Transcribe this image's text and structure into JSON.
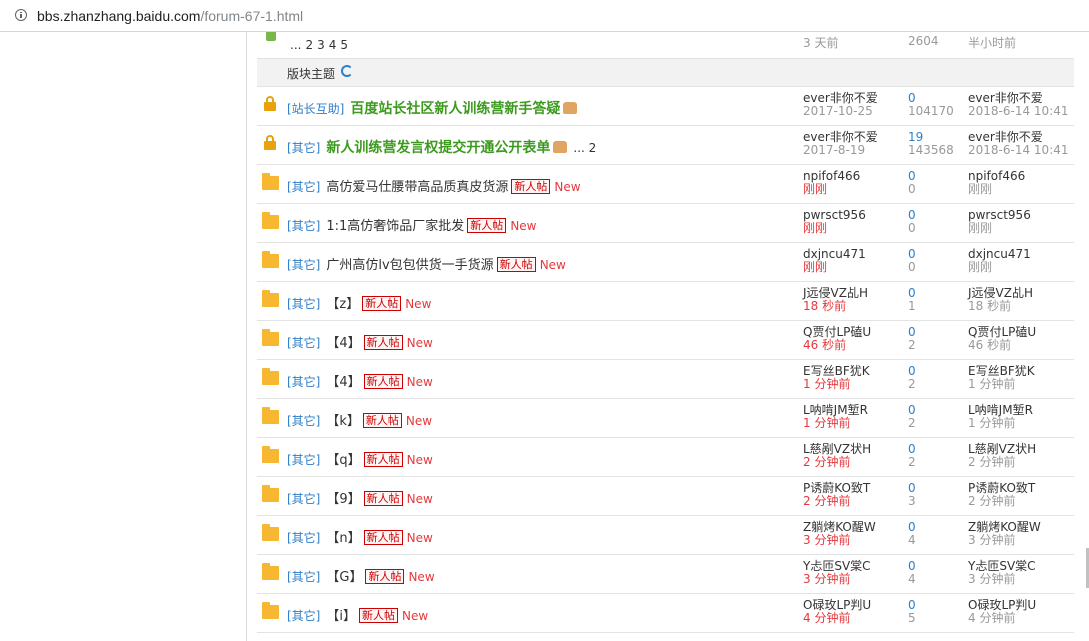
{
  "browser": {
    "url_host": "bbs.zhanzhang.baidu.com",
    "url_path": "/forum-67-1.html"
  },
  "prev_row": {
    "pages": [
      "...",
      "2",
      "3",
      "4",
      "5"
    ],
    "time": "3 天前",
    "count": "2604",
    "last": "半小时前"
  },
  "section": {
    "label": "版块主题"
  },
  "threads": [
    {
      "icon": "lock",
      "type": "[站长互助]",
      "subject": "百度站长社区新人训练营新手答疑",
      "highlight": true,
      "thumb": true,
      "pagelink": "",
      "newbie": "",
      "newtag": "",
      "author": "ever非你不爱",
      "date": "2017-10-25",
      "date_recent": false,
      "replies": "0",
      "views": "104170",
      "last_author": "ever非你不爱",
      "last_time": "2018-6-14 10:41"
    },
    {
      "icon": "lock",
      "type": "[其它]",
      "subject": "新人训练营发言权提交开通公开表单",
      "highlight": true,
      "thumb": true,
      "pagelink": "... 2",
      "newbie": "",
      "newtag": "",
      "author": "ever非你不爱",
      "date": "2017-8-19",
      "date_recent": false,
      "replies": "19",
      "views": "143568",
      "last_author": "ever非你不爱",
      "last_time": "2018-6-14 10:41"
    },
    {
      "icon": "folder",
      "type": "[其它]",
      "subject": "高仿爱马仕腰带高品质真皮货源",
      "highlight": false,
      "thumb": false,
      "pagelink": "",
      "newbie": "新人帖",
      "newtag": "New",
      "author": "npifof466",
      "date": "刚刚",
      "date_recent": true,
      "replies": "0",
      "views": "0",
      "last_author": "npifof466",
      "last_time": "刚刚"
    },
    {
      "icon": "folder",
      "type": "[其它]",
      "subject": "1:1高仿奢饰品厂家批发",
      "highlight": false,
      "thumb": false,
      "pagelink": "",
      "newbie": "新人帖",
      "newtag": "New",
      "author": "pwrsct956",
      "date": "刚刚",
      "date_recent": true,
      "replies": "0",
      "views": "0",
      "last_author": "pwrsct956",
      "last_time": "刚刚"
    },
    {
      "icon": "folder",
      "type": "[其它]",
      "subject": "广州高仿lv包包供货一手货源",
      "highlight": false,
      "thumb": false,
      "pagelink": "",
      "newbie": "新人帖",
      "newtag": "New",
      "author": "dxjncu471",
      "date": "刚刚",
      "date_recent": true,
      "replies": "0",
      "views": "0",
      "last_author": "dxjncu471",
      "last_time": "刚刚"
    },
    {
      "icon": "folder",
      "type": "[其它]",
      "subject": "【z】",
      "highlight": false,
      "thumb": false,
      "pagelink": "",
      "newbie": "新人帖",
      "newtag": "New",
      "author": "J远侵VZ乩H",
      "date": "18 秒前",
      "date_recent": true,
      "replies": "0",
      "views": "1",
      "last_author": "J远侵VZ乩H",
      "last_time": "18 秒前"
    },
    {
      "icon": "folder",
      "type": "[其它]",
      "subject": "【4】",
      "highlight": false,
      "thumb": false,
      "pagelink": "",
      "newbie": "新人帖",
      "newtag": "New",
      "author": "Q贾付LP磕U",
      "date": "46 秒前",
      "date_recent": true,
      "replies": "0",
      "views": "2",
      "last_author": "Q贾付LP磕U",
      "last_time": "46 秒前"
    },
    {
      "icon": "folder",
      "type": "[其它]",
      "subject": "【4】",
      "highlight": false,
      "thumb": false,
      "pagelink": "",
      "newbie": "新人帖",
      "newtag": "New",
      "author": "E写丝BF犹K",
      "date": "1 分钟前",
      "date_recent": true,
      "replies": "0",
      "views": "2",
      "last_author": "E写丝BF犹K",
      "last_time": "1 分钟前"
    },
    {
      "icon": "folder",
      "type": "[其它]",
      "subject": "【k】",
      "highlight": false,
      "thumb": false,
      "pagelink": "",
      "newbie": "新人帖",
      "newtag": "New",
      "author": "L呐啃JM堑R",
      "date": "1 分钟前",
      "date_recent": true,
      "replies": "0",
      "views": "2",
      "last_author": "L呐啃JM堑R",
      "last_time": "1 分钟前"
    },
    {
      "icon": "folder",
      "type": "[其它]",
      "subject": "【q】",
      "highlight": false,
      "thumb": false,
      "pagelink": "",
      "newbie": "新人帖",
      "newtag": "New",
      "author": "L慈剐VZ状H",
      "date": "2 分钟前",
      "date_recent": true,
      "replies": "0",
      "views": "2",
      "last_author": "L慈剐VZ状H",
      "last_time": "2 分钟前"
    },
    {
      "icon": "folder",
      "type": "[其它]",
      "subject": "【9】",
      "highlight": false,
      "thumb": false,
      "pagelink": "",
      "newbie": "新人帖",
      "newtag": "New",
      "author": "P诱蔚KO致T",
      "date": "2 分钟前",
      "date_recent": true,
      "replies": "0",
      "views": "3",
      "last_author": "P诱蔚KO致T",
      "last_time": "2 分钟前"
    },
    {
      "icon": "folder",
      "type": "[其它]",
      "subject": "【n】",
      "highlight": false,
      "thumb": false,
      "pagelink": "",
      "newbie": "新人帖",
      "newtag": "New",
      "author": "Z躺烤KO醒W",
      "date": "3 分钟前",
      "date_recent": true,
      "replies": "0",
      "views": "4",
      "last_author": "Z躺烤KO醒W",
      "last_time": "3 分钟前"
    },
    {
      "icon": "folder",
      "type": "[其它]",
      "subject": "【G】",
      "highlight": false,
      "thumb": false,
      "pagelink": "",
      "newbie": "新人帖",
      "newtag": "New",
      "author": "Y忐匝SV棠C",
      "date": "3 分钟前",
      "date_recent": true,
      "replies": "0",
      "views": "4",
      "last_author": "Y忐匝SV棠C",
      "last_time": "3 分钟前"
    },
    {
      "icon": "folder",
      "type": "[其它]",
      "subject": "【i】",
      "highlight": false,
      "thumb": false,
      "pagelink": "",
      "newbie": "新人帖",
      "newtag": "New",
      "author": "O碌玫LP判U",
      "date": "4 分钟前",
      "date_recent": true,
      "replies": "0",
      "views": "5",
      "last_author": "O碌玫LP判U",
      "last_time": "4 分钟前"
    }
  ]
}
